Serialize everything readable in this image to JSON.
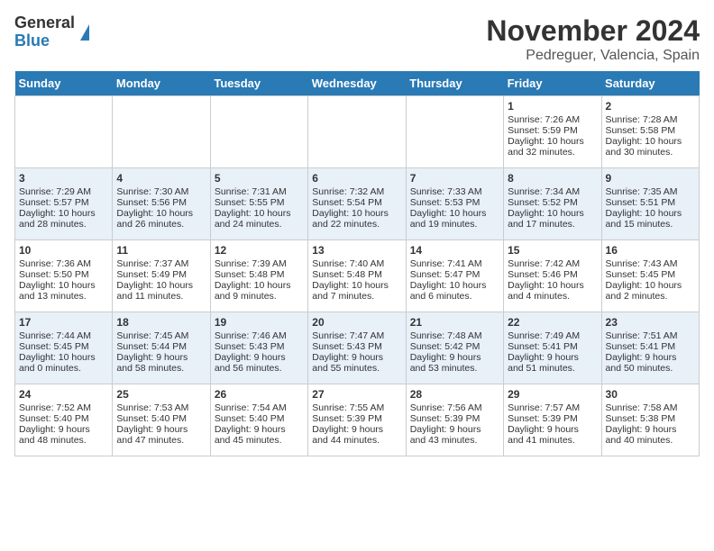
{
  "header": {
    "logo_line1": "General",
    "logo_line2": "Blue",
    "title": "November 2024",
    "subtitle": "Pedreguer, Valencia, Spain"
  },
  "days_of_week": [
    "Sunday",
    "Monday",
    "Tuesday",
    "Wednesday",
    "Thursday",
    "Friday",
    "Saturday"
  ],
  "weeks": [
    [
      {
        "day": "",
        "info": ""
      },
      {
        "day": "",
        "info": ""
      },
      {
        "day": "",
        "info": ""
      },
      {
        "day": "",
        "info": ""
      },
      {
        "day": "",
        "info": ""
      },
      {
        "day": "1",
        "info": "Sunrise: 7:26 AM\nSunset: 5:59 PM\nDaylight: 10 hours\nand 32 minutes."
      },
      {
        "day": "2",
        "info": "Sunrise: 7:28 AM\nSunset: 5:58 PM\nDaylight: 10 hours\nand 30 minutes."
      }
    ],
    [
      {
        "day": "3",
        "info": "Sunrise: 7:29 AM\nSunset: 5:57 PM\nDaylight: 10 hours\nand 28 minutes."
      },
      {
        "day": "4",
        "info": "Sunrise: 7:30 AM\nSunset: 5:56 PM\nDaylight: 10 hours\nand 26 minutes."
      },
      {
        "day": "5",
        "info": "Sunrise: 7:31 AM\nSunset: 5:55 PM\nDaylight: 10 hours\nand 24 minutes."
      },
      {
        "day": "6",
        "info": "Sunrise: 7:32 AM\nSunset: 5:54 PM\nDaylight: 10 hours\nand 22 minutes."
      },
      {
        "day": "7",
        "info": "Sunrise: 7:33 AM\nSunset: 5:53 PM\nDaylight: 10 hours\nand 19 minutes."
      },
      {
        "day": "8",
        "info": "Sunrise: 7:34 AM\nSunset: 5:52 PM\nDaylight: 10 hours\nand 17 minutes."
      },
      {
        "day": "9",
        "info": "Sunrise: 7:35 AM\nSunset: 5:51 PM\nDaylight: 10 hours\nand 15 minutes."
      }
    ],
    [
      {
        "day": "10",
        "info": "Sunrise: 7:36 AM\nSunset: 5:50 PM\nDaylight: 10 hours\nand 13 minutes."
      },
      {
        "day": "11",
        "info": "Sunrise: 7:37 AM\nSunset: 5:49 PM\nDaylight: 10 hours\nand 11 minutes."
      },
      {
        "day": "12",
        "info": "Sunrise: 7:39 AM\nSunset: 5:48 PM\nDaylight: 10 hours\nand 9 minutes."
      },
      {
        "day": "13",
        "info": "Sunrise: 7:40 AM\nSunset: 5:48 PM\nDaylight: 10 hours\nand 7 minutes."
      },
      {
        "day": "14",
        "info": "Sunrise: 7:41 AM\nSunset: 5:47 PM\nDaylight: 10 hours\nand 6 minutes."
      },
      {
        "day": "15",
        "info": "Sunrise: 7:42 AM\nSunset: 5:46 PM\nDaylight: 10 hours\nand 4 minutes."
      },
      {
        "day": "16",
        "info": "Sunrise: 7:43 AM\nSunset: 5:45 PM\nDaylight: 10 hours\nand 2 minutes."
      }
    ],
    [
      {
        "day": "17",
        "info": "Sunrise: 7:44 AM\nSunset: 5:45 PM\nDaylight: 10 hours\nand 0 minutes."
      },
      {
        "day": "18",
        "info": "Sunrise: 7:45 AM\nSunset: 5:44 PM\nDaylight: 9 hours\nand 58 minutes."
      },
      {
        "day": "19",
        "info": "Sunrise: 7:46 AM\nSunset: 5:43 PM\nDaylight: 9 hours\nand 56 minutes."
      },
      {
        "day": "20",
        "info": "Sunrise: 7:47 AM\nSunset: 5:43 PM\nDaylight: 9 hours\nand 55 minutes."
      },
      {
        "day": "21",
        "info": "Sunrise: 7:48 AM\nSunset: 5:42 PM\nDaylight: 9 hours\nand 53 minutes."
      },
      {
        "day": "22",
        "info": "Sunrise: 7:49 AM\nSunset: 5:41 PM\nDaylight: 9 hours\nand 51 minutes."
      },
      {
        "day": "23",
        "info": "Sunrise: 7:51 AM\nSunset: 5:41 PM\nDaylight: 9 hours\nand 50 minutes."
      }
    ],
    [
      {
        "day": "24",
        "info": "Sunrise: 7:52 AM\nSunset: 5:40 PM\nDaylight: 9 hours\nand 48 minutes."
      },
      {
        "day": "25",
        "info": "Sunrise: 7:53 AM\nSunset: 5:40 PM\nDaylight: 9 hours\nand 47 minutes."
      },
      {
        "day": "26",
        "info": "Sunrise: 7:54 AM\nSunset: 5:40 PM\nDaylight: 9 hours\nand 45 minutes."
      },
      {
        "day": "27",
        "info": "Sunrise: 7:55 AM\nSunset: 5:39 PM\nDaylight: 9 hours\nand 44 minutes."
      },
      {
        "day": "28",
        "info": "Sunrise: 7:56 AM\nSunset: 5:39 PM\nDaylight: 9 hours\nand 43 minutes."
      },
      {
        "day": "29",
        "info": "Sunrise: 7:57 AM\nSunset: 5:39 PM\nDaylight: 9 hours\nand 41 minutes."
      },
      {
        "day": "30",
        "info": "Sunrise: 7:58 AM\nSunset: 5:38 PM\nDaylight: 9 hours\nand 40 minutes."
      }
    ]
  ]
}
